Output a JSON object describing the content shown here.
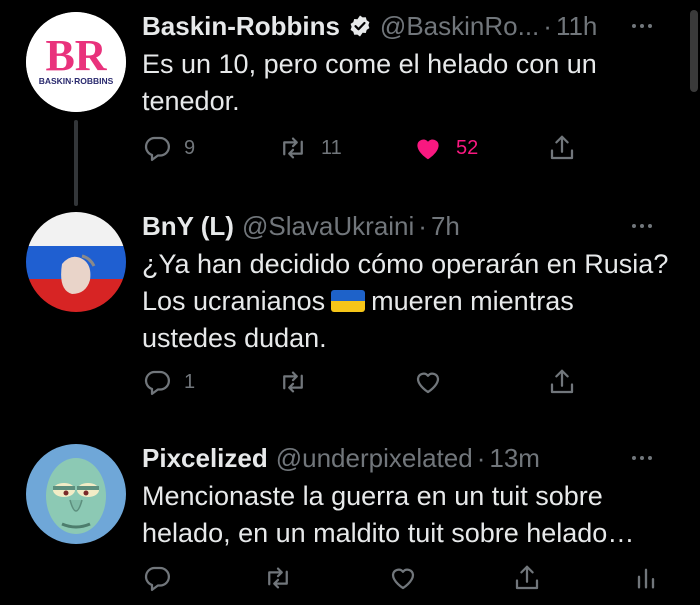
{
  "tweets": [
    {
      "name": "Baskin-Robbins",
      "handle": "@BaskinRo...",
      "separator": "·",
      "time": "11h",
      "verified": true,
      "avatar": {
        "logo_letters": "BR",
        "logo_subtext": "BASKIN·ROBBINS",
        "colors": [
          "#e9327c",
          "#2a2a6e"
        ]
      },
      "text_lines": [
        "Es un 10, pero come el helado con un",
        "tenedor."
      ],
      "actions": {
        "replies": "9",
        "retweets": "11",
        "likes": "52",
        "liked": true
      }
    },
    {
      "name": "BnY (L)",
      "handle": "@SlavaUkraini",
      "separator": "·",
      "time": "7h",
      "verified": false,
      "avatar_icon": "russian-flag-avatar",
      "text_lines": [
        "¿Ya han decidido cómo operarán en Rusia?",
        "Los ucranianos",
        "mueren mientras",
        "ustedes dudan."
      ],
      "inline_emoji": "ukraine-flag-emoji",
      "actions": {
        "replies": "1",
        "retweets": "",
        "likes": "",
        "liked": false
      }
    },
    {
      "name": "Pixcelized",
      "handle": "@underpixelated",
      "separator": "·",
      "time": "13m",
      "verified": false,
      "avatar_icon": "squidward-avatar",
      "text_lines": [
        "Mencionaste la guerra en un tuit sobre",
        "helado, en un maldito tuit sobre helado…"
      ],
      "actions": {
        "replies": "",
        "retweets": "",
        "likes": "",
        "liked": false
      }
    }
  ],
  "colors": {
    "background": "#000000",
    "text": "#e7e9ea",
    "muted": "#71767b",
    "like": "#f91880",
    "divider": "#333639"
  }
}
